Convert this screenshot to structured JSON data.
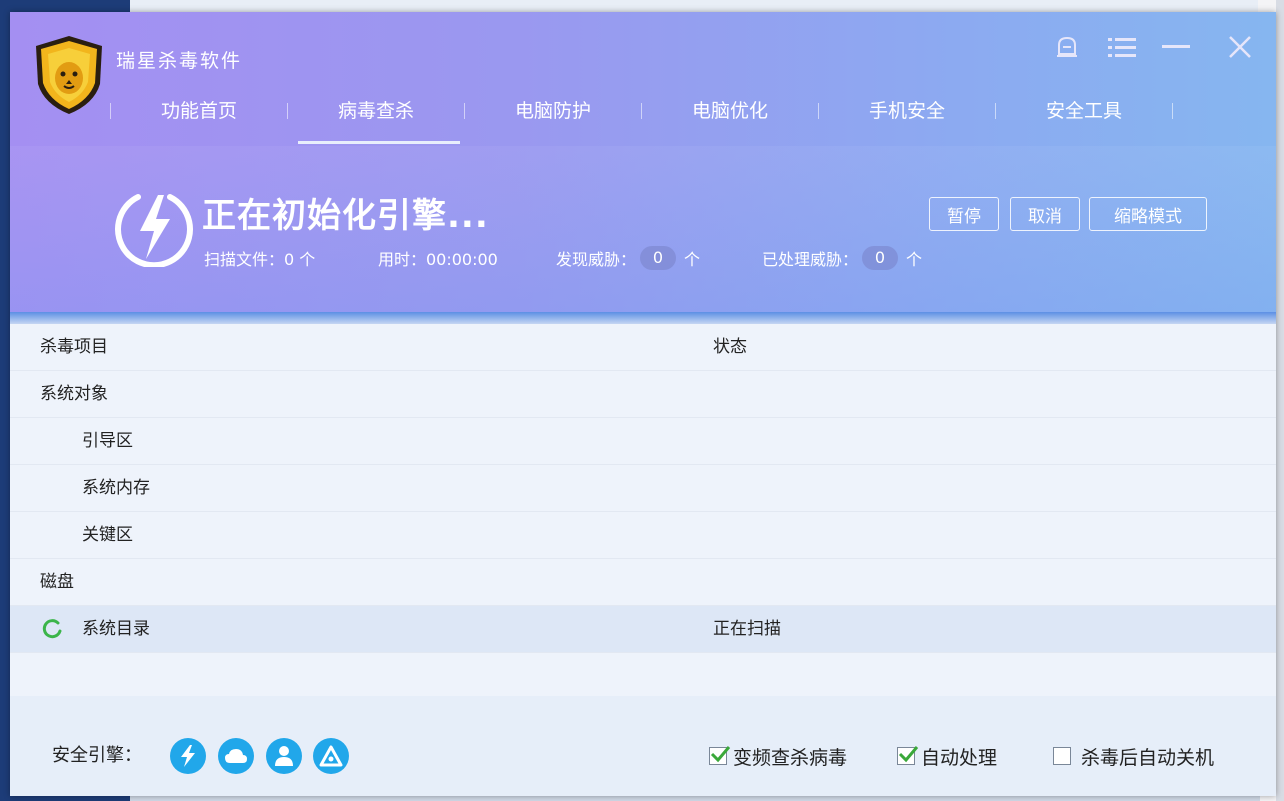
{
  "app": {
    "title": "瑞星杀毒软件"
  },
  "nav": {
    "items": [
      {
        "label": "功能首页"
      },
      {
        "label": "病毒查杀",
        "active": true
      },
      {
        "label": "电脑防护"
      },
      {
        "label": "电脑优化"
      },
      {
        "label": "手机安全"
      },
      {
        "label": "安全工具"
      }
    ]
  },
  "scan": {
    "title": "正在初始化引擎...",
    "files_label": "扫描文件：0 个",
    "time_label": "用时：00:00:00",
    "threats_label": "发现威胁：",
    "threats_value": "0",
    "threats_unit": "个",
    "handled_label": "已处理威胁：",
    "handled_value": "0",
    "handled_unit": "个"
  },
  "buttons": {
    "pause": "暂停",
    "cancel": "取消",
    "mini_mode": "缩略模式"
  },
  "table": {
    "col_item": "杀毒项目",
    "col_status": "状态",
    "rows": [
      {
        "name": "系统对象",
        "status": ""
      },
      {
        "name": "引导区",
        "status": ""
      },
      {
        "name": "系统内存",
        "status": ""
      },
      {
        "name": "关键区",
        "status": ""
      },
      {
        "name": "磁盘",
        "status": ""
      },
      {
        "name": "系统目录",
        "status": "正在扫描"
      }
    ]
  },
  "footer": {
    "engine_label": "安全引擎：",
    "engines": [
      "lightning-engine-icon",
      "cloud-engine-icon",
      "user-engine-icon",
      "triangle-engine-icon"
    ],
    "options": [
      {
        "label": "变频查杀病毒",
        "checked": true
      },
      {
        "label": "自动处理",
        "checked": true
      },
      {
        "label": "杀毒后自动关机",
        "checked": false
      }
    ]
  },
  "colors": {
    "header_start": "#a48ff2",
    "header_end": "#86b6f0",
    "engine_blue": "#21a7ea",
    "check_green": "#3aa83a",
    "spinner_green": "#3bb54a"
  }
}
